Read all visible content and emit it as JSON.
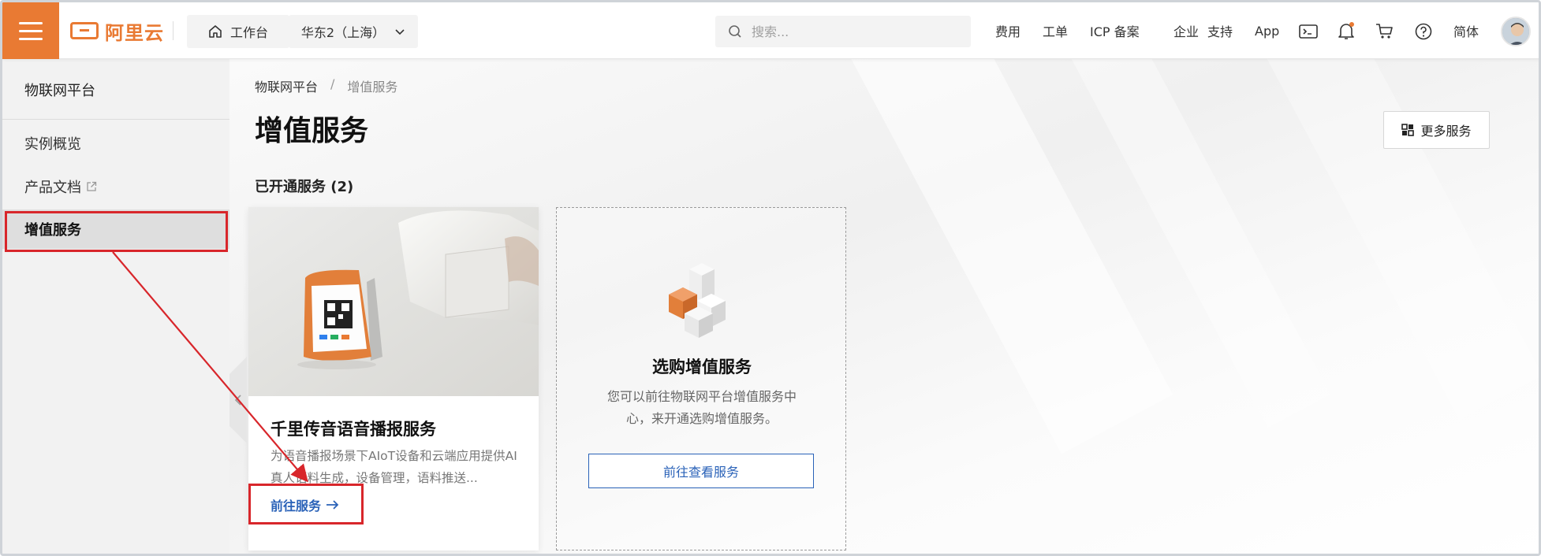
{
  "topbar": {
    "logo_text": "阿里云",
    "workbench_label": "工作台",
    "region_label": "华东2（上海）",
    "search_placeholder": "搜索...",
    "nav": [
      "费用",
      "工单",
      "ICP 备案",
      "企业",
      "支持",
      "App"
    ],
    "language": "简体",
    "accent_color": "#e97a33"
  },
  "sidebar": {
    "title": "物联网平台",
    "items": [
      {
        "label": "实例概览"
      },
      {
        "label": "产品文档"
      },
      {
        "label": "增值服务"
      }
    ]
  },
  "main": {
    "breadcrumb": [
      "物联网平台",
      "/",
      "增值服务"
    ],
    "page_title": "增值服务",
    "more_services_label": "更多服务",
    "section_title": "已开通服务 (2)",
    "service_card": {
      "title": "千里传音语音播报服务",
      "description": "为语音播报场景下AIoT设备和云端应用提供AI真人语料生成，设备管理，语料推送...",
      "link_label": "前往服务",
      "link_color": "#2a62b8"
    },
    "buy_card": {
      "title": "选购增值服务",
      "description": "您可以前往物联网平台增值服务中心，来开通选购增值服务。",
      "button_label": "前往查看服务"
    }
  },
  "annotation": {
    "color": "#d8262b"
  }
}
